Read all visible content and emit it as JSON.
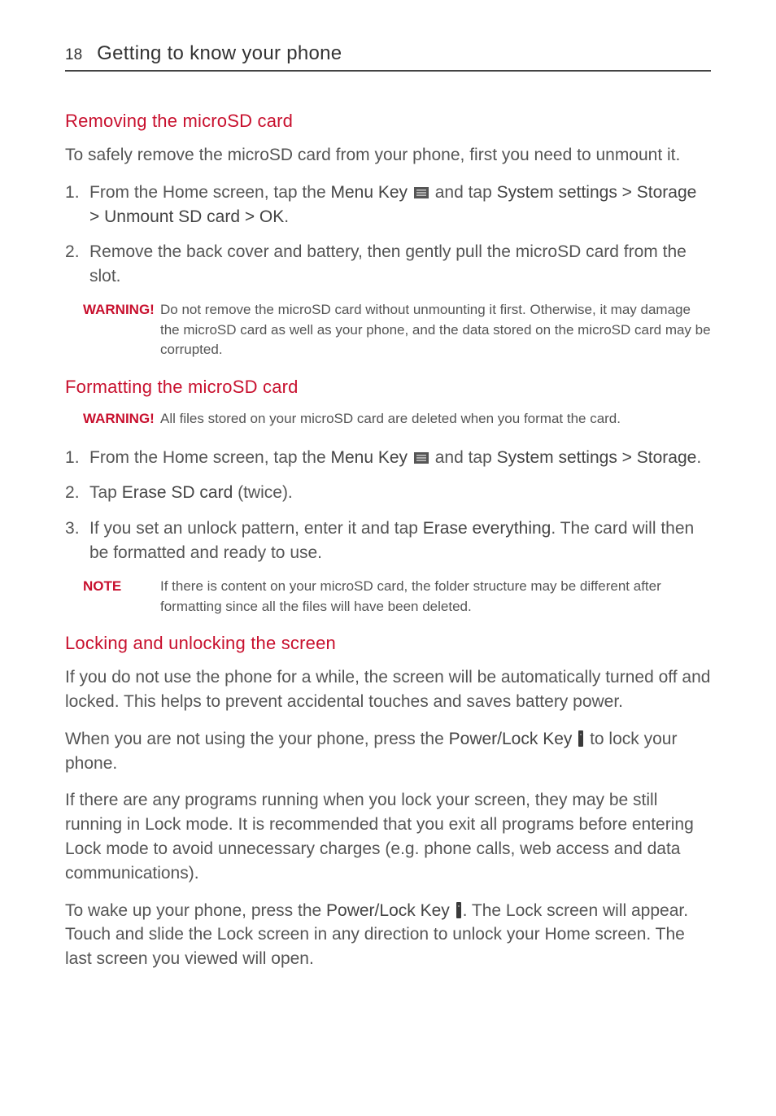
{
  "header": {
    "page_number": "18",
    "title": "Getting to know your phone"
  },
  "section1": {
    "heading": "Removing the microSD card",
    "intro": "To safely remove the microSD card from your phone, first you need to unmount it.",
    "step1_a": "From the Home screen, tap the ",
    "step1_b": "Menu Key",
    "step1_c": " and tap ",
    "step1_d": "System settings > Storage > Unmount SD card > OK",
    "step1_e": ".",
    "step2": "Remove the back cover and battery, then gently pull the microSD card from the slot.",
    "warning_label": "WARNING!",
    "warning_text": "Do not remove the microSD card without unmounting it first. Otherwise, it may damage the microSD card as well as your phone, and the data stored on the microSD card may be corrupted."
  },
  "section2": {
    "heading": "Formatting the microSD card",
    "warning_label": "WARNING!",
    "warning_text": "All files stored on your microSD card are deleted when you format the card.",
    "step1_a": "From the Home screen, tap the ",
    "step1_b": "Menu Key",
    "step1_c": " and tap ",
    "step1_d": "System settings > Storage",
    "step1_e": ".",
    "step2_a": "Tap ",
    "step2_b": "Erase SD card",
    "step2_c": " (twice).",
    "step3_a": "If you set an unlock pattern, enter it and tap ",
    "step3_b": "Erase everything",
    "step3_c": ". The card will then be formatted and ready to use.",
    "note_label": "NOTE",
    "note_text": "If there is content on your microSD card, the folder structure may be different after formatting since all the files will have been deleted."
  },
  "section3": {
    "heading": "Locking and unlocking the screen",
    "p1": "If you do not use the phone for a while, the screen will be automatically turned off and locked. This helps to prevent accidental touches and saves battery power.",
    "p2_a": "When you are not using the your phone, press the ",
    "p2_b": "Power/Lock Key",
    "p2_c": " to lock your phone.",
    "p3": "If there are any programs running when you lock your screen, they may be still running in Lock mode. It is recommended that you exit all programs before entering Lock mode to avoid unnecessary charges (e.g. phone calls, web access and data communications).",
    "p4_a": "To wake up your phone, press the ",
    "p4_b": "Power/Lock Key",
    "p4_c": ". The Lock screen will appear. Touch and slide the Lock screen in any direction to unlock your Home screen. The last screen you viewed will open."
  }
}
